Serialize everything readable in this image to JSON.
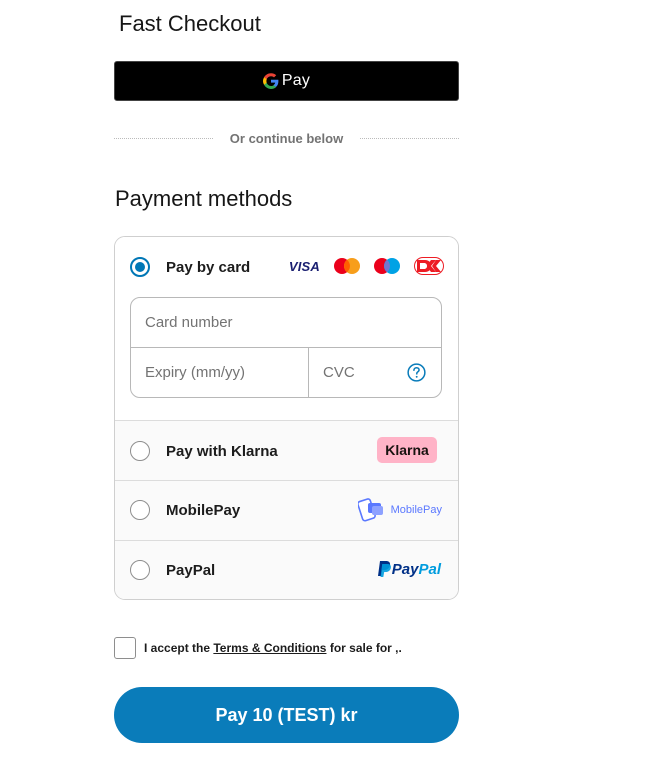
{
  "fast_checkout": {
    "title": "Fast Checkout",
    "gpay_label": "Pay",
    "divider_text": "Or continue below"
  },
  "payment": {
    "heading": "Payment methods",
    "card": {
      "label": "Pay by card",
      "selected": true,
      "brands": {
        "visa": "VISA",
        "icons": [
          "mastercard-icon",
          "maestro-icon",
          "dankort-icon"
        ]
      },
      "card_number_placeholder": "Card number",
      "expiry_placeholder": "Expiry (mm/yy)",
      "cvc_placeholder": "CVC"
    },
    "options": [
      {
        "label": "Pay with Klarna",
        "logo_text": "Klarna",
        "selected": false
      },
      {
        "label": "MobilePay",
        "logo_text": "MobilePay",
        "selected": false
      },
      {
        "label": "PayPal",
        "logo_text_1": "Pay",
        "logo_text_2": "Pal",
        "selected": false
      }
    ]
  },
  "terms": {
    "prefix": "I accept the ",
    "link": "Terms & Conditions",
    "suffix": " for sale for ,.",
    "checked": false
  },
  "pay_button": {
    "label": "Pay 10 (TEST) kr"
  },
  "colors": {
    "accent": "#0a7cba",
    "radio_selected": "#0077b6",
    "klarna_pink": "#ffb3c7",
    "paypal_dark": "#003087",
    "paypal_light": "#009cde",
    "mobilepay": "#5a78ff"
  }
}
